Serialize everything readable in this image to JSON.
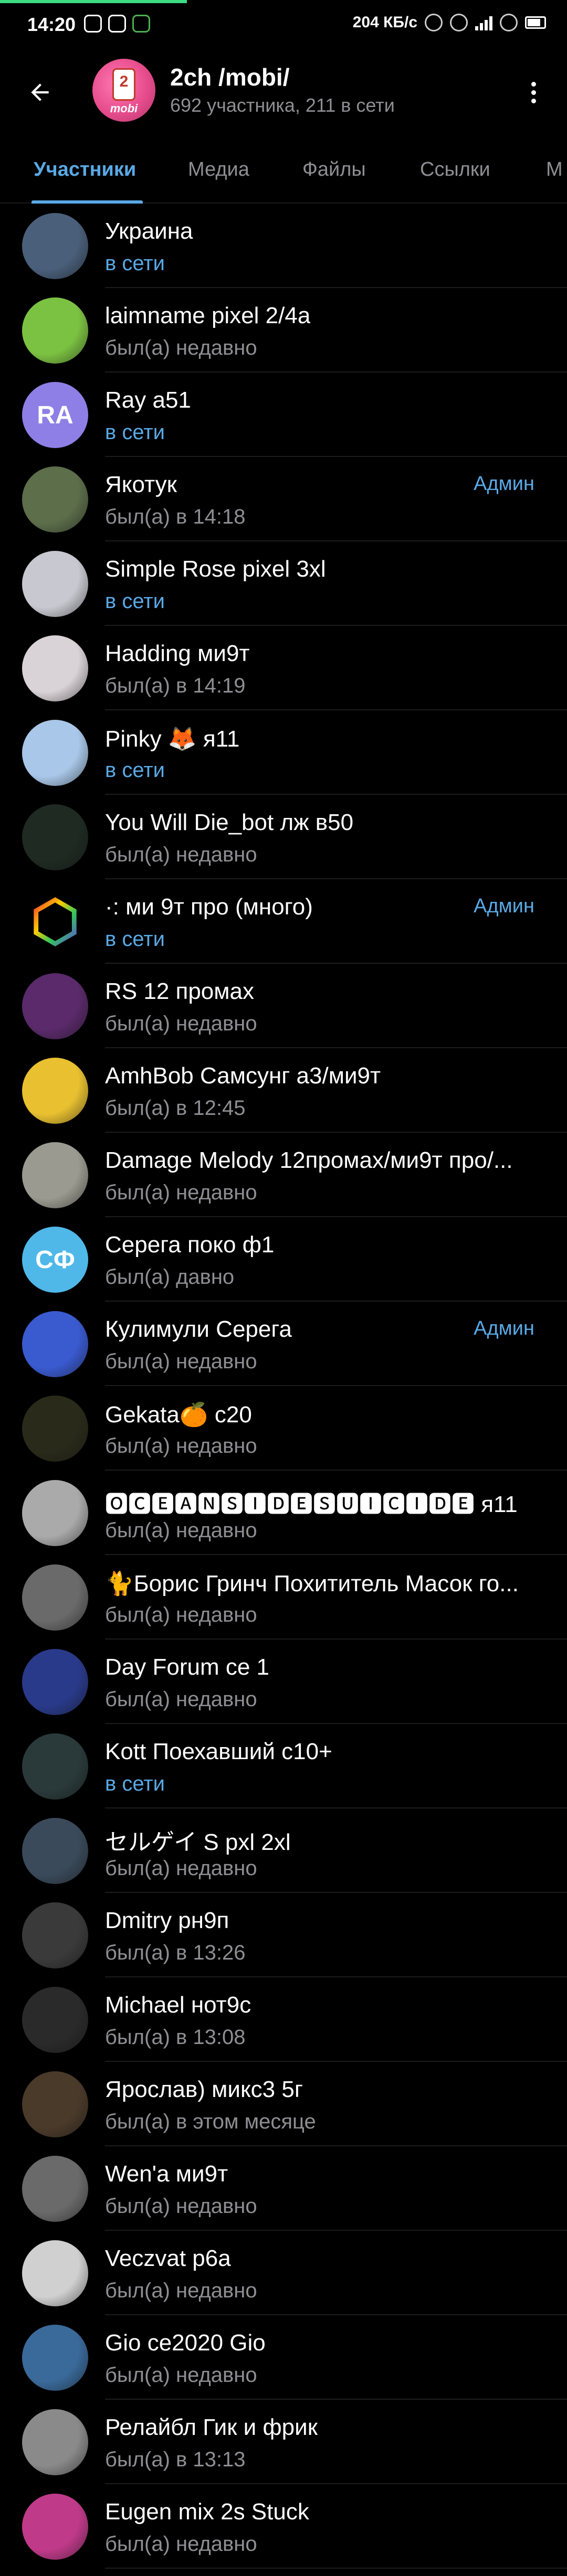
{
  "status_bar": {
    "time": "14:20",
    "speed": "204 КБ/с",
    "accent_color": "#3ddc84"
  },
  "header": {
    "title": "2ch /mobi/",
    "subtitle": "692 участника, 211 в сети",
    "avatar_label": "mobi"
  },
  "tabs": [
    {
      "label": "Участники",
      "active": true
    },
    {
      "label": "Медиа",
      "active": false
    },
    {
      "label": "Файлы",
      "active": false
    },
    {
      "label": "Ссылки",
      "active": false
    },
    {
      "label": "М",
      "active": false
    }
  ],
  "members": [
    {
      "name": "Украина",
      "status": "в сети",
      "online": true,
      "role": "",
      "initials": "",
      "avatar_color": "#4a5f7a"
    },
    {
      "name": "laimname pixel 2/4a",
      "status": "был(а) недавно",
      "online": false,
      "role": "",
      "initials": "",
      "avatar_color": "#7cc242"
    },
    {
      "name": "Ray a51",
      "status": "в сети",
      "online": true,
      "role": "",
      "initials": "RA",
      "avatar_color": "#8e7fe6"
    },
    {
      "name": "Якотук",
      "status": "был(а) в 14:18",
      "online": false,
      "role": "Админ",
      "initials": "",
      "avatar_color": "#5c6e4a"
    },
    {
      "name": "Simple Rose pixel 3xl",
      "status": "в сети",
      "online": true,
      "role": "",
      "initials": "",
      "avatar_color": "#c8c8d0"
    },
    {
      "name": "Hadding ми9т",
      "status": "был(а) в 14:19",
      "online": false,
      "role": "",
      "initials": "",
      "avatar_color": "#d9d2d6"
    },
    {
      "name": "Pinky 🦊 я11",
      "status": "в сети",
      "online": true,
      "role": "",
      "initials": "",
      "avatar_color": "#a9c7e8"
    },
    {
      "name": "You Will Die_bot лж в50",
      "status": "был(а) недавно",
      "online": false,
      "role": "",
      "initials": "",
      "avatar_color": "#1e2a22"
    },
    {
      "name": "·: ми 9т про (много)",
      "status": "в сети",
      "online": true,
      "role": "Админ",
      "initials": "",
      "avatar_color": "#000000"
    },
    {
      "name": "RS 12 промах",
      "status": "был(а) недавно",
      "online": false,
      "role": "",
      "initials": "",
      "avatar_color": "#5a2a6a"
    },
    {
      "name": "AmhBob Самсунг а3/ми9т",
      "status": "был(а) в 12:45",
      "online": false,
      "role": "",
      "initials": "",
      "avatar_color": "#e8c030"
    },
    {
      "name": "Damage Melody 12промах/ми9т про/...",
      "status": "был(а) недавно",
      "online": false,
      "role": "",
      "initials": "",
      "avatar_color": "#9a9a90"
    },
    {
      "name": "Серега поко ф1",
      "status": "был(а) давно",
      "online": false,
      "role": "",
      "initials": "СФ",
      "avatar_color": "#4fb8e8"
    },
    {
      "name": "Кулимули Серега",
      "status": "был(а) недавно",
      "online": false,
      "role": "Админ",
      "initials": "",
      "avatar_color": "#3a5ad0"
    },
    {
      "name": "Gekata🍊 c20",
      "status": "был(а) недавно",
      "online": false,
      "role": "",
      "initials": "",
      "avatar_color": "#2a2a1a"
    },
    {
      "name": "🅾🅲🅴🅰🅽🆂🅸🅳🅴🆂🆄🅸🅲🅸🅳🅴 я11",
      "status": "был(а) недавно",
      "online": false,
      "role": "",
      "initials": "",
      "avatar_color": "#aaaaaa"
    },
    {
      "name": "🐈Борис Гринч Похититель Масок го...",
      "status": "был(а) недавно",
      "online": false,
      "role": "",
      "initials": "",
      "avatar_color": "#6a6a6a"
    },
    {
      "name": "Day Forum ce 1",
      "status": "был(а) недавно",
      "online": false,
      "role": "",
      "initials": "",
      "avatar_color": "#2a3a8a"
    },
    {
      "name": "Kott Поехавший c10+",
      "status": "в сети",
      "online": true,
      "role": "",
      "initials": "",
      "avatar_color": "#2a3a3a"
    },
    {
      "name": "セルゲイ S pxl 2xl",
      "status": "был(а) недавно",
      "online": false,
      "role": "",
      "initials": "",
      "avatar_color": "#3a4a5a"
    },
    {
      "name": "Dmitry рн9п",
      "status": "был(а) в 13:26",
      "online": false,
      "role": "",
      "initials": "",
      "avatar_color": "#3a3a3a"
    },
    {
      "name": "Michael нот9с",
      "status": "был(а) в 13:08",
      "online": false,
      "role": "",
      "initials": "",
      "avatar_color": "#2a2a2a"
    },
    {
      "name": "Ярослав) микс3 5г",
      "status": "был(а) в этом месяце",
      "online": false,
      "role": "",
      "initials": "",
      "avatar_color": "#4a3a2a"
    },
    {
      "name": "Wen'a ми9т",
      "status": "был(а) недавно",
      "online": false,
      "role": "",
      "initials": "",
      "avatar_color": "#6a6a6a"
    },
    {
      "name": "Veczvat р6а",
      "status": "был(а) недавно",
      "online": false,
      "role": "",
      "initials": "",
      "avatar_color": "#d0d0d0"
    },
    {
      "name": "Gio ce2020 Gio",
      "status": "был(а) недавно",
      "online": false,
      "role": "",
      "initials": "",
      "avatar_color": "#3a6a9a"
    },
    {
      "name": "Релайбл Гик и фрик",
      "status": "был(а) в 13:13",
      "online": false,
      "role": "",
      "initials": "",
      "avatar_color": "#8a8a8a"
    },
    {
      "name": "Eugen mix 2s Stuck",
      "status": "был(а) недавно",
      "online": false,
      "role": "",
      "initials": "",
      "avatar_color": "#c03a8a"
    }
  ]
}
